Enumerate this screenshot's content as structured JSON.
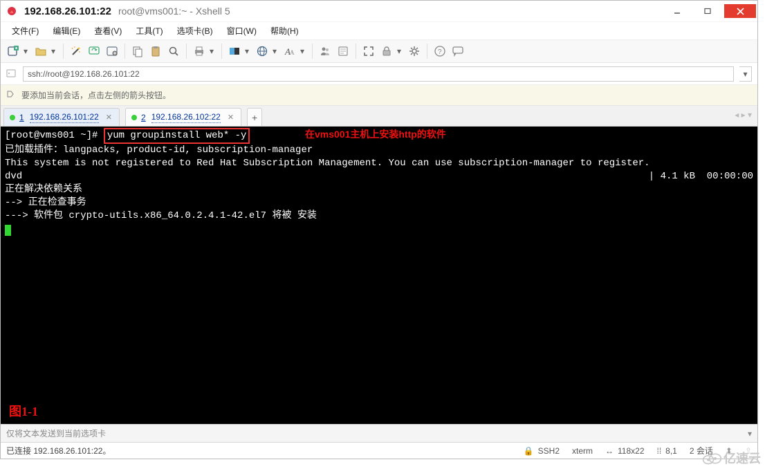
{
  "window": {
    "ip_label": "192.168.26.101:22",
    "title_rest": "root@vms001:~ - Xshell 5"
  },
  "menu": {
    "file": "文件(F)",
    "edit": "编辑(E)",
    "view": "查看(V)",
    "tools": "工具(T)",
    "tab": "选项卡(B)",
    "window": "窗口(W)",
    "help": "帮助(H)"
  },
  "address": {
    "url": "ssh://root@192.168.26.101:22"
  },
  "infobar": {
    "text": "要添加当前会话，点击左侧的箭头按钮。"
  },
  "tabs": [
    {
      "num": "1",
      "label": "192.168.26.101:22",
      "active": true
    },
    {
      "num": "2",
      "label": "192.168.26.102:22",
      "active": false
    }
  ],
  "terminal": {
    "prompt": "[root@vms001 ~]# ",
    "command": "yum groupinstall web* -y",
    "annotation": "在vms001主机上安装http的软件",
    "lines": [
      "已加载插件：langpacks, product-id, subscription-manager",
      "This system is not registered to Red Hat Subscription Management. You can use subscription-manager to register."
    ],
    "dvd_line_left": "dvd",
    "dvd_line_right": "| 4.1 kB  00:00:00",
    "lines2": [
      "正在解决依赖关系",
      "--> 正在检查事务",
      "---> 软件包 crypto-utils.x86_64.0.2.4.1-42.el7 将被 安装"
    ],
    "figure_label": "图1-1"
  },
  "sendbar": {
    "placeholder": "仅将文本发送到当前选项卡"
  },
  "status": {
    "connected": "已连接 192.168.26.101:22。",
    "ssh": "SSH2",
    "term": "xterm",
    "size": "118x22",
    "pos": "8,1",
    "sessions": "2 会话"
  },
  "watermark": {
    "text": "亿速云"
  },
  "icons": {
    "new_file": "new-file-icon",
    "open": "open-folder-icon",
    "wand": "wand-icon",
    "reconnect": "reconnect-icon",
    "properties": "properties-icon",
    "copy": "copy-icon",
    "paste": "paste-icon",
    "find": "find-icon",
    "print": "print-icon",
    "color": "color-scheme-icon",
    "globe": "globe-icon",
    "font": "font-icon",
    "users": "users-icon",
    "script": "script-icon",
    "fullscreen": "fullscreen-icon",
    "lock": "lock-icon",
    "gear": "gear-icon",
    "help": "help-icon",
    "chat": "chat-icon"
  }
}
